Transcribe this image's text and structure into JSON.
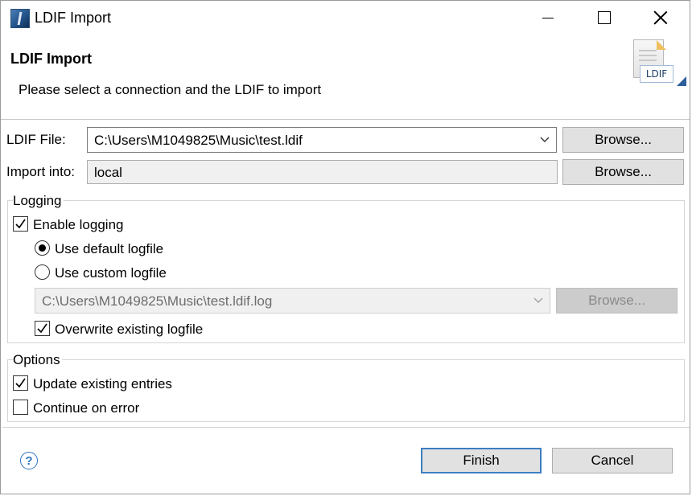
{
  "window": {
    "title": "LDIF Import"
  },
  "banner": {
    "title": "LDIF Import",
    "description": "Please select a connection and the LDIF to import",
    "icon_text": "LDIF"
  },
  "ldif_file": {
    "label": "LDIF File:",
    "value": "C:\\Users\\M1049825\\Music\\test.ldif",
    "browse_label": "Browse..."
  },
  "import_into": {
    "label": "Import into:",
    "value": "local",
    "browse_label": "Browse..."
  },
  "logging": {
    "group_title": "Logging",
    "enable_logging": {
      "label": "Enable logging",
      "checked": true
    },
    "use_default": {
      "label": "Use default logfile",
      "selected": true
    },
    "use_custom": {
      "label": "Use custom logfile",
      "selected": false
    },
    "logfile_path": "C:\\Users\\M1049825\\Music\\test.ldif.log",
    "browse_label": "Browse...",
    "overwrite": {
      "label": "Overwrite existing logfile",
      "checked": true
    }
  },
  "options": {
    "group_title": "Options",
    "update_existing": {
      "label": "Update existing entries",
      "checked": true
    },
    "continue_on_error": {
      "label": "Continue on error",
      "checked": false
    }
  },
  "footer": {
    "help_symbol": "?",
    "finish_label": "Finish",
    "cancel_label": "Cancel"
  }
}
